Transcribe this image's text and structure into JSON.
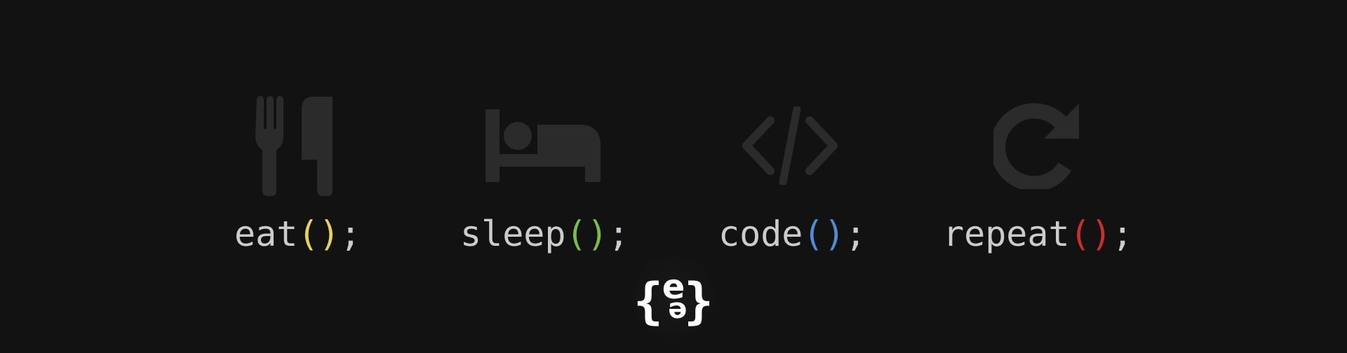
{
  "colors": {
    "background": "#121212",
    "icon": "#2b2b2b",
    "text": "#cccccc",
    "paren_eat": "#e6d25a",
    "paren_sleep": "#7cbf3f",
    "paren_code": "#4f8cd6",
    "paren_repeat": "#c9302c",
    "logo": "#ffffff"
  },
  "items": [
    {
      "icon": "fork-knife-icon",
      "name": "eat",
      "open": "(",
      "close": ")",
      "end": ";"
    },
    {
      "icon": "bed-icon",
      "name": "sleep",
      "open": "(",
      "close": ")",
      "end": ";"
    },
    {
      "icon": "code-brackets-icon",
      "name": "code",
      "open": "(",
      "close": ")",
      "end": ";"
    },
    {
      "icon": "redo-icon",
      "name": "repeat",
      "open": "(",
      "close": ")",
      "end": ";"
    }
  ],
  "logo": {
    "icon": "curly-brace-logo",
    "left_brace": "{",
    "right_brace": "}",
    "top_letter": "e",
    "bottom_letter": "ə"
  }
}
